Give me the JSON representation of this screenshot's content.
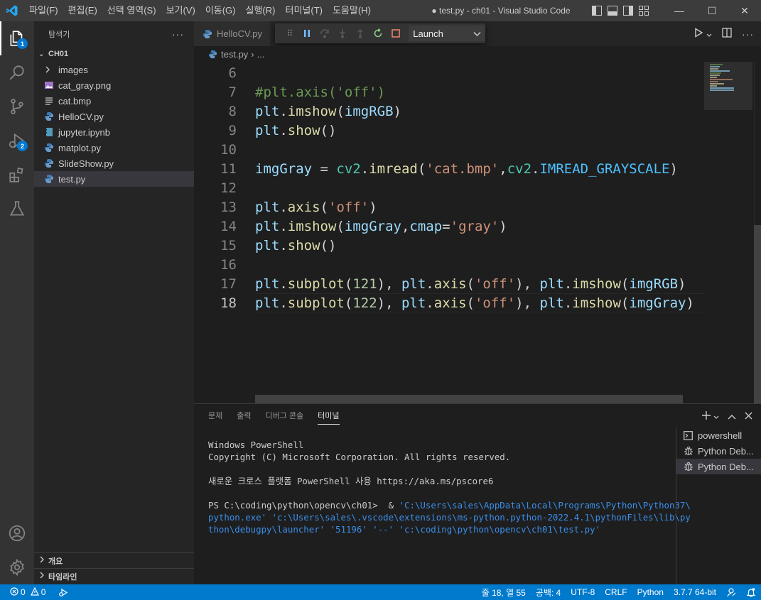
{
  "window": {
    "title": "● test.py - ch01 - Visual Studio Code",
    "menu": [
      "파일(F)",
      "편집(E)",
      "선택 영역(S)",
      "보기(V)",
      "이동(G)",
      "실행(R)",
      "터미널(T)",
      "도움말(H)"
    ],
    "minimize": "—",
    "maximize": "☐",
    "close": "✕"
  },
  "activity": {
    "explorer_badge": "1",
    "debug_badge": "2"
  },
  "sidebar": {
    "header": "탐색기",
    "more": "···",
    "folder": "CH01",
    "items": [
      {
        "label": "images",
        "kind": "folder"
      },
      {
        "label": "cat_gray.png",
        "kind": "image"
      },
      {
        "label": "cat.bmp",
        "kind": "text"
      },
      {
        "label": "HelloCV.py",
        "kind": "python"
      },
      {
        "label": "jupyter.ipynb",
        "kind": "notebook"
      },
      {
        "label": "matplot.py",
        "kind": "python"
      },
      {
        "label": "SlideShow.py",
        "kind": "python"
      },
      {
        "label": "test.py",
        "kind": "python"
      }
    ],
    "outline": "개요",
    "timeline": "타임라인"
  },
  "editor": {
    "tab_label": "HelloCV.py",
    "debug_config": "Launch",
    "breadcrumb_file": "test.py",
    "breadcrumb_sep": "›",
    "breadcrumb_more": "...",
    "lines": [
      {
        "n": "6",
        "code": ""
      },
      {
        "n": "7",
        "code": "#plt.axis('off')"
      },
      {
        "n": "8",
        "code": "plt.imshow(imgRGB)"
      },
      {
        "n": "9",
        "code": "plt.show()"
      },
      {
        "n": "10",
        "code": ""
      },
      {
        "n": "11",
        "code": "imgGray = cv2.imread('cat.bmp',cv2.IMREAD_GRAYSCALE)"
      },
      {
        "n": "12",
        "code": ""
      },
      {
        "n": "13",
        "code": "plt.axis('off')"
      },
      {
        "n": "14",
        "code": "plt.imshow(imgGray,cmap='gray')"
      },
      {
        "n": "15",
        "code": "plt.show()"
      },
      {
        "n": "16",
        "code": ""
      },
      {
        "n": "17",
        "code": "plt.subplot(121), plt.axis('off'), plt.imshow(imgRGB)"
      },
      {
        "n": "18",
        "code": "plt.subplot(122), plt.axis('off'), plt.imshow(imgGray)"
      }
    ]
  },
  "panel": {
    "tabs": [
      "문제",
      "출력",
      "디버그 콘솔",
      "터미널"
    ],
    "active_tab": "터미널",
    "terminal": {
      "l1": "Windows PowerShell",
      "l2": "Copyright (C) Microsoft Corporation. All rights reserved.",
      "l3": "새로운 크로스 플랫폼 PowerShell 사용 https://aka.ms/pscore6",
      "prompt": "PS C:\\coding\\python\\opencv\\ch01>  & ",
      "cmd1": "'C:\\Users\\sales\\AppData\\Local\\Programs\\Python\\Python37\\",
      "cmd2": "python.exe' 'c:\\Users\\sales\\.vscode\\extensions\\ms-python.python-2022.4.1\\pythonFiles\\lib\\py",
      "cmd3": "thon\\debugpy\\launcher' '51196' '--' 'c:\\coding\\python\\opencv\\ch01\\test.py'"
    },
    "terminals": [
      "powershell",
      "Python Deb...",
      "Python Deb..."
    ]
  },
  "status": {
    "errors": "0",
    "warnings": "0",
    "position": "줄 18, 열 55",
    "spaces": "공백: 4",
    "encoding": "UTF-8",
    "eol": "CRLF",
    "language": "Python",
    "interpreter": "3.7.7 64-bit"
  }
}
